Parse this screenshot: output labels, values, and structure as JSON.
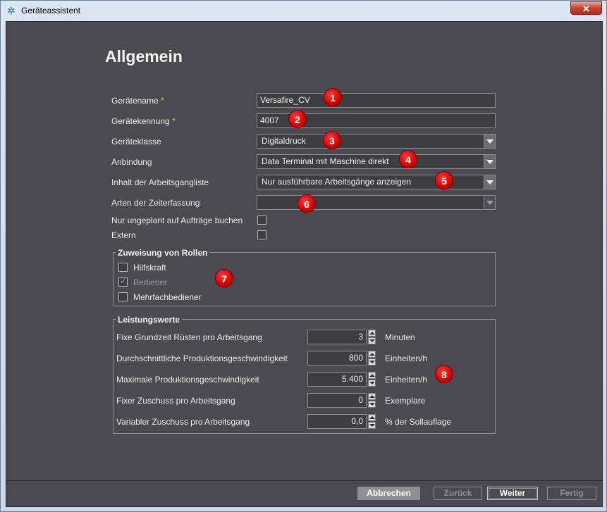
{
  "window": {
    "title": "Geräteassistent",
    "close_label": "✕"
  },
  "section_title": "Allgemein",
  "required_mark": "*",
  "form": {
    "device_name": {
      "label": "Gerätename",
      "value": "Versafire_CV",
      "badge": "1"
    },
    "device_id": {
      "label": "Gerätekennung",
      "value": "4007",
      "badge": "2"
    },
    "device_class": {
      "label": "Geräteklasse",
      "value": "Digitaldruck",
      "badge": "3"
    },
    "connection": {
      "label": "Anbindung",
      "value": "Data Terminal mit Maschine direkt",
      "badge": "4"
    },
    "operation_list": {
      "label": "Inhalt der Arbeitsgangliste",
      "value": "Nur ausführbare Arbeitsgänge anzeigen",
      "badge": "5"
    },
    "time_recording": {
      "label": "Arten der Zeiterfassung",
      "value": "",
      "badge": "6"
    },
    "unplanned_only": {
      "label": "Nur ungeplant auf Aufträge buchen",
      "checked": false
    },
    "external": {
      "label": "Extern",
      "checked": false
    }
  },
  "roles": {
    "title": "Zuweisung von Rollen",
    "badge": "7",
    "items": [
      {
        "label": "Hilfskraft",
        "checked": false,
        "enabled": true
      },
      {
        "label": "Bediener",
        "checked": true,
        "enabled": false
      },
      {
        "label": "Mehrfachbediener",
        "checked": false,
        "enabled": true
      }
    ]
  },
  "performance": {
    "title": "Leistungswerte",
    "badge": "8",
    "rows": [
      {
        "label": "Fixe Grundzeit Rüsten pro Arbeitsgang",
        "value": "3",
        "unit": "Minuten"
      },
      {
        "label": "Durchschnittliche Produktionsgeschwindigkeit",
        "value": "800",
        "unit": "Einheiten/h"
      },
      {
        "label": "Maximale Produktionsgeschwindigkeit",
        "value": "5.400",
        "unit": "Einheiten/h"
      },
      {
        "label": "Fixer Zuschuss pro Arbeitsgang",
        "value": "0",
        "unit": "Exemplare"
      },
      {
        "label": "Variabler Zuschuss pro Arbeitsgang",
        "value": "0,0",
        "unit": "% der Sollauflage"
      }
    ]
  },
  "footer": {
    "cancel": "Abbrechen",
    "back": "Zurück",
    "next": "Weiter",
    "finish": "Fertig"
  }
}
